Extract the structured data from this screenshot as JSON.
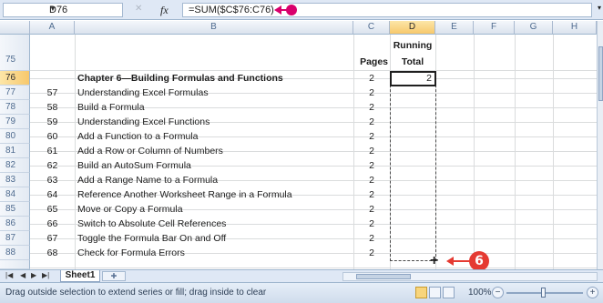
{
  "formula_bar": {
    "name_box": "D76",
    "fx_label": "fx",
    "formula": "=SUM($C$76:C76)"
  },
  "columns": [
    "A",
    "B",
    "C",
    "D",
    "E",
    "F",
    "G",
    "H"
  ],
  "headers": {
    "pages": "Pages",
    "running_total_line1": "Running",
    "running_total_line2": "Total"
  },
  "rows": [
    {
      "row": "75",
      "num": "",
      "title": "",
      "pages": "",
      "total": ""
    },
    {
      "row": "76",
      "num": "",
      "title": "Chapter 6—Building Formulas and Functions",
      "pages": "2",
      "total": "2"
    },
    {
      "row": "77",
      "num": "57",
      "title": "Understanding Excel Formulas",
      "pages": "2",
      "total": ""
    },
    {
      "row": "78",
      "num": "58",
      "title": "Build a Formula",
      "pages": "2",
      "total": ""
    },
    {
      "row": "79",
      "num": "59",
      "title": "Understanding Excel Functions",
      "pages": "2",
      "total": ""
    },
    {
      "row": "80",
      "num": "60",
      "title": "Add a Function to a Formula",
      "pages": "2",
      "total": ""
    },
    {
      "row": "81",
      "num": "61",
      "title": "Add a Row or Column of Numbers",
      "pages": "2",
      "total": ""
    },
    {
      "row": "82",
      "num": "62",
      "title": "Build an AutoSum Formula",
      "pages": "2",
      "total": ""
    },
    {
      "row": "83",
      "num": "63",
      "title": "Add a Range Name to a Formula",
      "pages": "2",
      "total": ""
    },
    {
      "row": "84",
      "num": "64",
      "title": "Reference Another Worksheet Range in a Formula",
      "pages": "2",
      "total": ""
    },
    {
      "row": "85",
      "num": "65",
      "title": "Move or Copy a Formula",
      "pages": "2",
      "total": ""
    },
    {
      "row": "86",
      "num": "66",
      "title": "Switch to Absolute Cell References",
      "pages": "2",
      "total": ""
    },
    {
      "row": "87",
      "num": "67",
      "title": "Toggle the Formula Bar On and Off",
      "pages": "2",
      "total": ""
    },
    {
      "row": "88",
      "num": "68",
      "title": "Check for Formula Errors",
      "pages": "2",
      "total": ""
    }
  ],
  "step_badge": "6",
  "sheet_tab": "Sheet1",
  "status_message": "Drag outside selection to extend series or fill; drag inside to clear",
  "zoom": "100%",
  "colors": {
    "annotation_arrow": "#d9006c",
    "step_badge": "#e53a32",
    "selected_header": "#f7c86c"
  }
}
